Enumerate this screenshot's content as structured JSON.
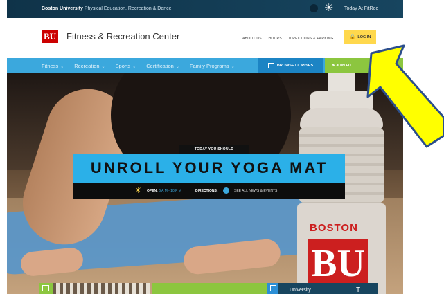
{
  "topbar": {
    "org_bold": "Boston University",
    "org_rest": " Physical Education, Recreation & Dance",
    "today_link": "Today At FitRec"
  },
  "header": {
    "logo_text": "BU",
    "site_title": "Fitness & Recreation Center",
    "util_nav": [
      "ABOUT US",
      "HOURS",
      "DIRECTIONS & PARKING"
    ],
    "login_label": "LOG IN"
  },
  "mainnav": {
    "items": [
      "Fitness",
      "Recreation",
      "Sports",
      "Certification",
      "Family Programs"
    ],
    "browse_label": "BROWSE CLASSES",
    "join_label": "JOIN FIT"
  },
  "hero": {
    "kicker": "TODAY YOU SHOULD",
    "headline": "UNROLL YOUR YOGA MAT",
    "open_label": "OPEN:",
    "open_hours": "6 A M - 10 P M",
    "directions_label": "DIRECTIONS:",
    "see_all": "SEE ALL NEWS & EVENTS",
    "bottle_text_1": "BOSTON",
    "bottle_text_2": "BU"
  },
  "tiles": {
    "teal_text": "University",
    "teal_right": "T"
  },
  "colors": {
    "accent_blue": "#3ba8dd",
    "join_green": "#8cc63f",
    "login_yellow": "#ffd84d",
    "bu_red": "#cc0000",
    "annotation_yellow": "#ffff00"
  }
}
